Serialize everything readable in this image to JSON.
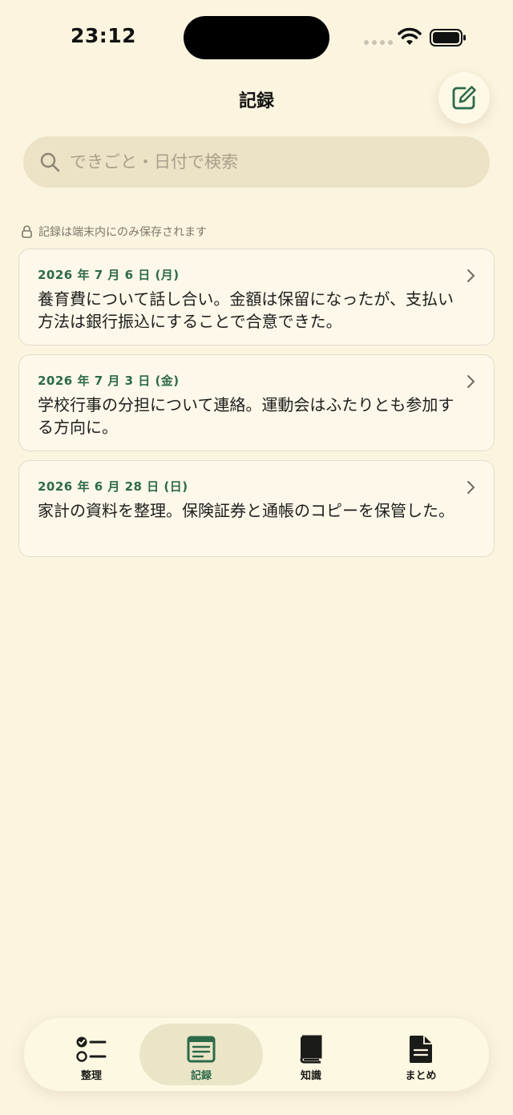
{
  "status_bar": {
    "time": "23:12"
  },
  "header": {
    "title": "記録"
  },
  "search": {
    "placeholder": "できごと・日付で検索"
  },
  "privacy_note": "記録は端末内にのみ保存されます",
  "records": [
    {
      "date": "2026 年 7 月 6 日 (月)",
      "text": "養育費について話し合い。金額は保留になったが、支払い方法は銀行振込にすることで合意できた。"
    },
    {
      "date": "2026 年 7 月 3 日 (金)",
      "text": "学校行事の分担について連絡。運動会はふたりとも参加する方向に。"
    },
    {
      "date": "2026 年 6 月 28 日 (日)",
      "text": "家計の資料を整理。保険証券と通帳のコピーを保管した。"
    }
  ],
  "tabs": [
    {
      "label": "整理",
      "icon": "checklist-icon",
      "active": false
    },
    {
      "label": "記録",
      "icon": "journal-icon",
      "active": true
    },
    {
      "label": "知識",
      "icon": "book-icon",
      "active": false
    },
    {
      "label": "まとめ",
      "icon": "document-icon",
      "active": false
    }
  ],
  "colors": {
    "background": "#fbf4df",
    "accent": "#2d6a4a",
    "card": "#fdf8ea",
    "search": "#ece3c6"
  }
}
